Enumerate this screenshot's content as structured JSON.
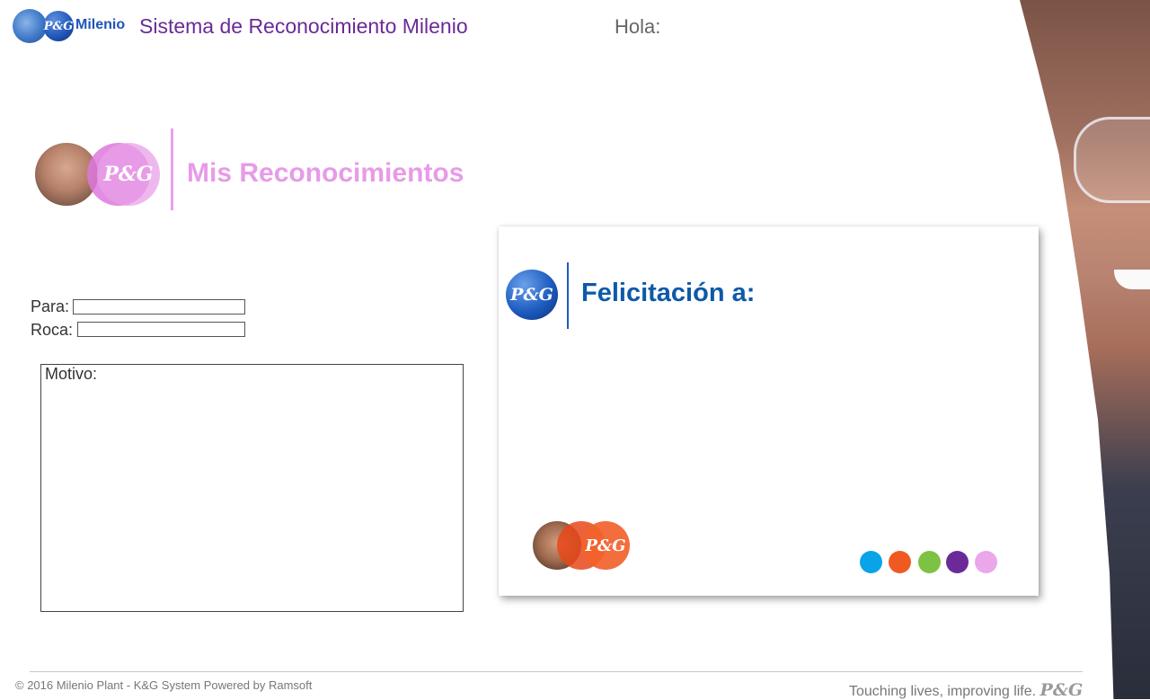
{
  "header": {
    "logo_pg": "P&G",
    "logo_text": "Milenio",
    "app_title": "Sistema de Reconocimiento Milenio",
    "greeting": "Hola:"
  },
  "section": {
    "logo_pg": "P&G",
    "title": "Mis Reconocimientos"
  },
  "form": {
    "para_label": "Para:",
    "para_value": "",
    "roca_label": "Roca:",
    "roca_value": "",
    "motivo_label": "Motivo:"
  },
  "card": {
    "logo_pg": "P&G",
    "title": "Felicitación a:",
    "footer_logo_pg": "P&G",
    "dots": [
      "#0aa3e8",
      "#f05a22",
      "#7dc242",
      "#6a2a97",
      "#eaa7ea"
    ]
  },
  "footer": {
    "copyright": "© 2016 Milenio Plant - K&G System Powered by Ramsoft",
    "tagline": "Touching lives, improving life.",
    "tagline_logo": "P&G"
  },
  "colors": {
    "title_purple": "#6a2a97",
    "section_pink": "#e79be7",
    "card_blue": "#0d5aa8"
  }
}
